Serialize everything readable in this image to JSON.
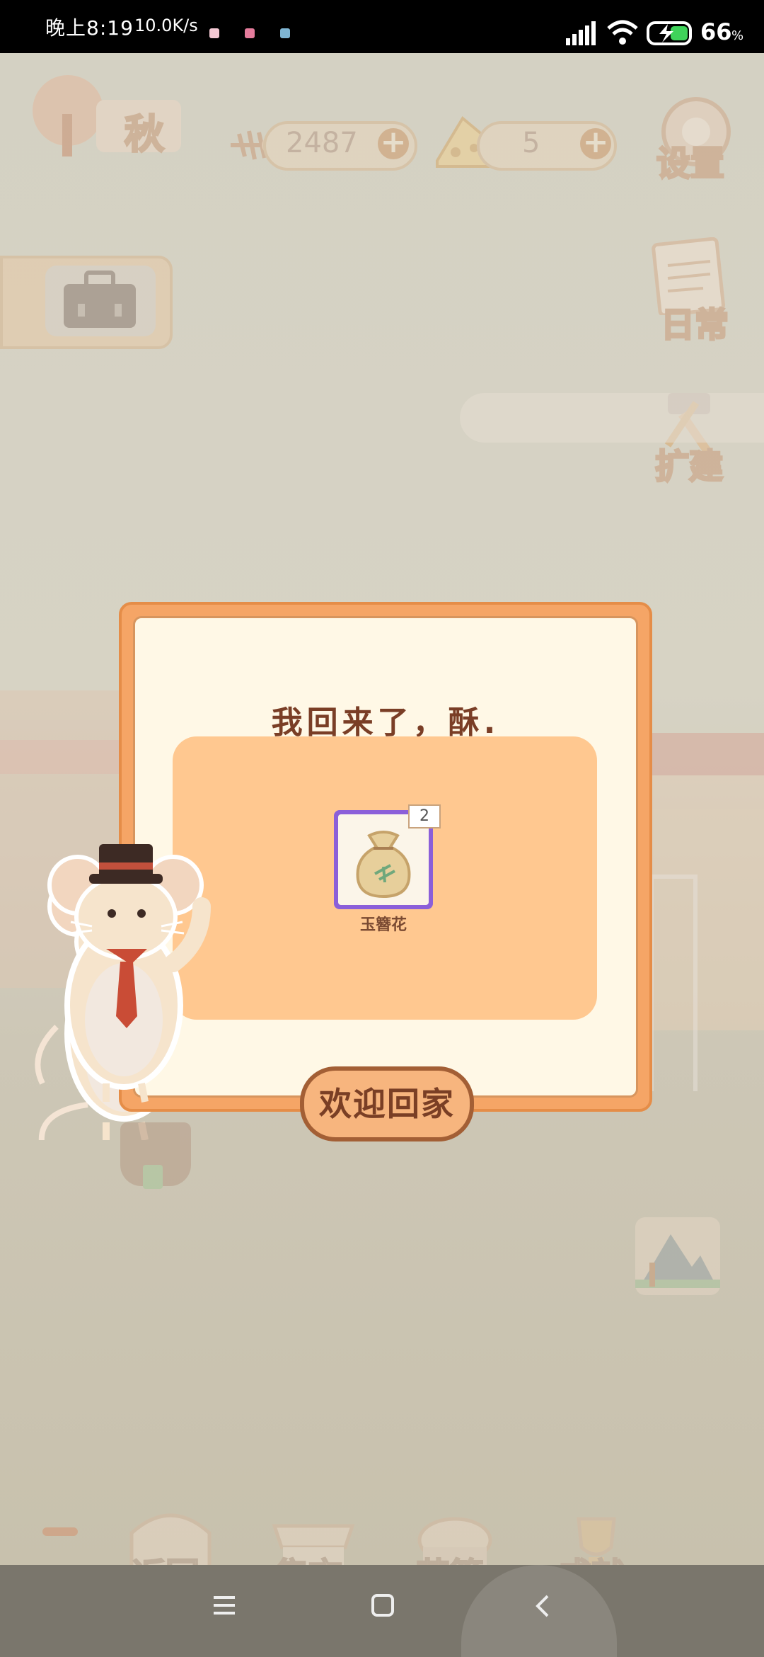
{
  "status_bar": {
    "time": "晚上8:19",
    "net_speed": "10.0K/s",
    "battery": "66",
    "battery_unit": "%"
  },
  "hud": {
    "season": "秋",
    "fish_count": "2487",
    "cheese_count": "5",
    "plus": "+",
    "settings_label": "设置",
    "daily_label": "日常",
    "expand_label": "扩建"
  },
  "dialog": {
    "title": "我回来了，酥.",
    "item_name": "玉簪花",
    "item_count": "2",
    "welcome_button": "欢迎回家"
  },
  "bottom_nav": {
    "back": "返回",
    "market": "集市",
    "basket": "花篮",
    "achievement": "成就"
  },
  "colors": {
    "dialog_border": "#f5a566",
    "panel": "#ffc890",
    "item_frame": "#8b5fd9"
  }
}
